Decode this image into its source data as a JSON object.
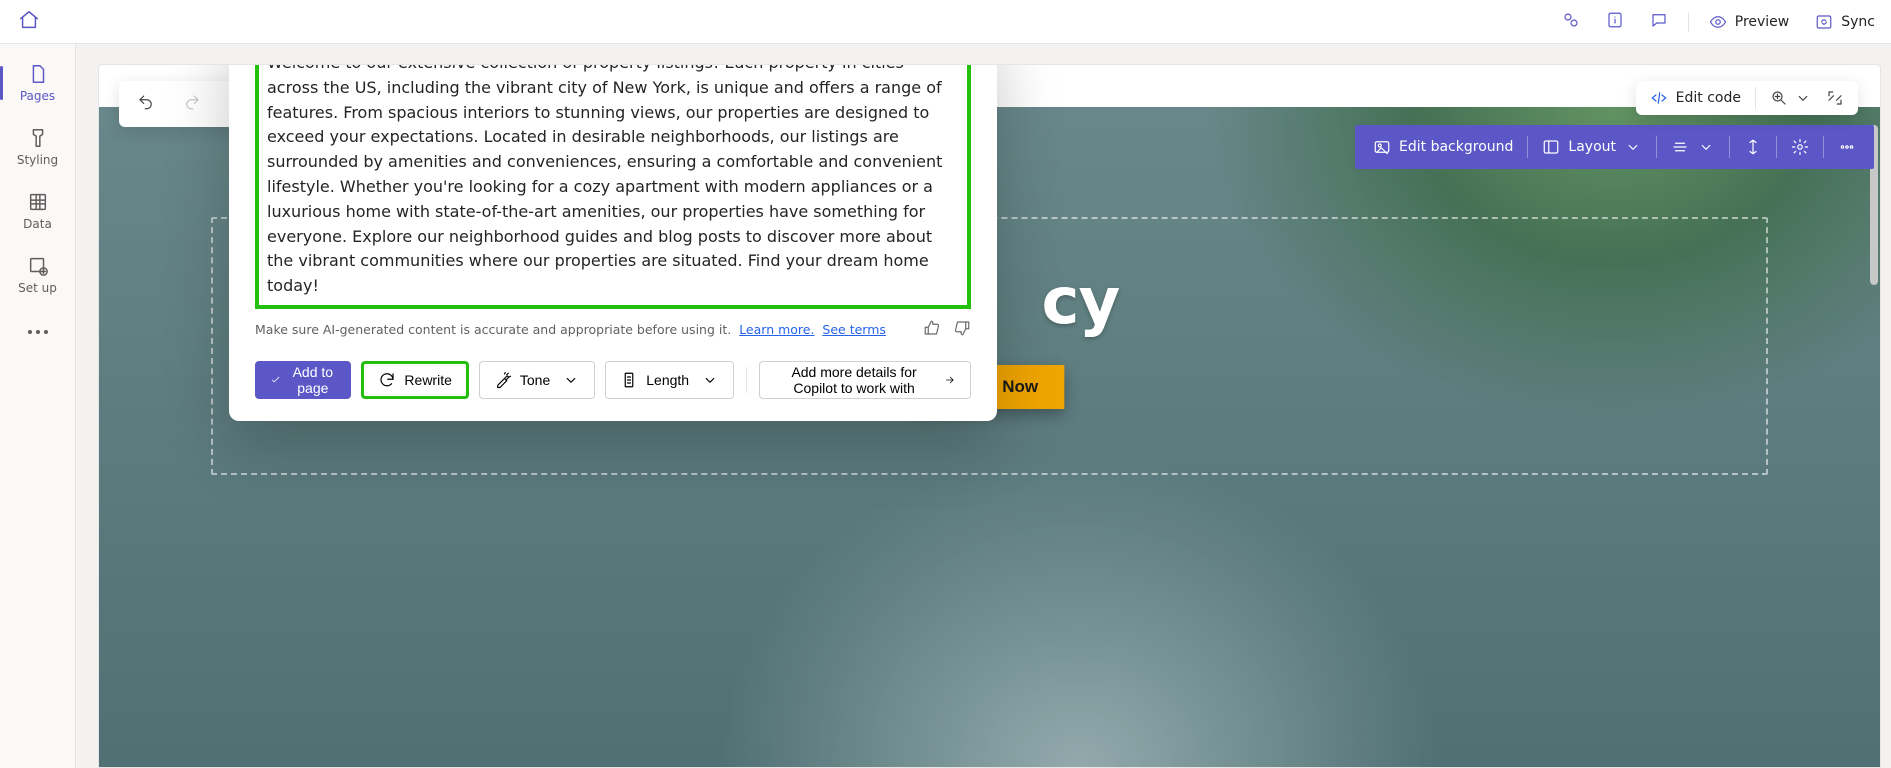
{
  "topbar": {
    "preview_label": "Preview",
    "sync_label": "Sync"
  },
  "rail": {
    "items": [
      {
        "id": "pages",
        "label": "Pages"
      },
      {
        "id": "styling",
        "label": "Styling"
      },
      {
        "id": "data",
        "label": "Data"
      },
      {
        "id": "setup",
        "label": "Set up"
      }
    ]
  },
  "editcode": {
    "label": "Edit code"
  },
  "section_toolbar": {
    "edit_bg": "Edit background",
    "layout": "Layout"
  },
  "hero": {
    "partial_title": "cy",
    "cta": "Search Now"
  },
  "copilot": {
    "generated_text": "Welcome to our extensive collection of property listings! Each property in cities across the US, including the vibrant city of New York, is unique and offers a range of features. From spacious interiors to stunning views, our properties are designed to exceed your expectations. Located in desirable neighborhoods, our listings are surrounded by amenities and conveniences, ensuring a comfortable and convenient lifestyle. Whether you're looking for a cozy apartment with modern appliances or a luxurious home with state-of-the-art amenities, our properties have something for everyone. Explore our neighborhood guides and blog posts to discover more about the vibrant communities where our properties are situated. Find your dream home today!",
    "disclaimer_text": "Make sure AI-generated content is accurate and appropriate before using it.",
    "learn_more": "Learn more.",
    "see_terms": "See terms",
    "add_to_page": "Add to page",
    "rewrite": "Rewrite",
    "tone": "Tone",
    "length": "Length",
    "more_details": "Add more details for Copilot to work with"
  }
}
